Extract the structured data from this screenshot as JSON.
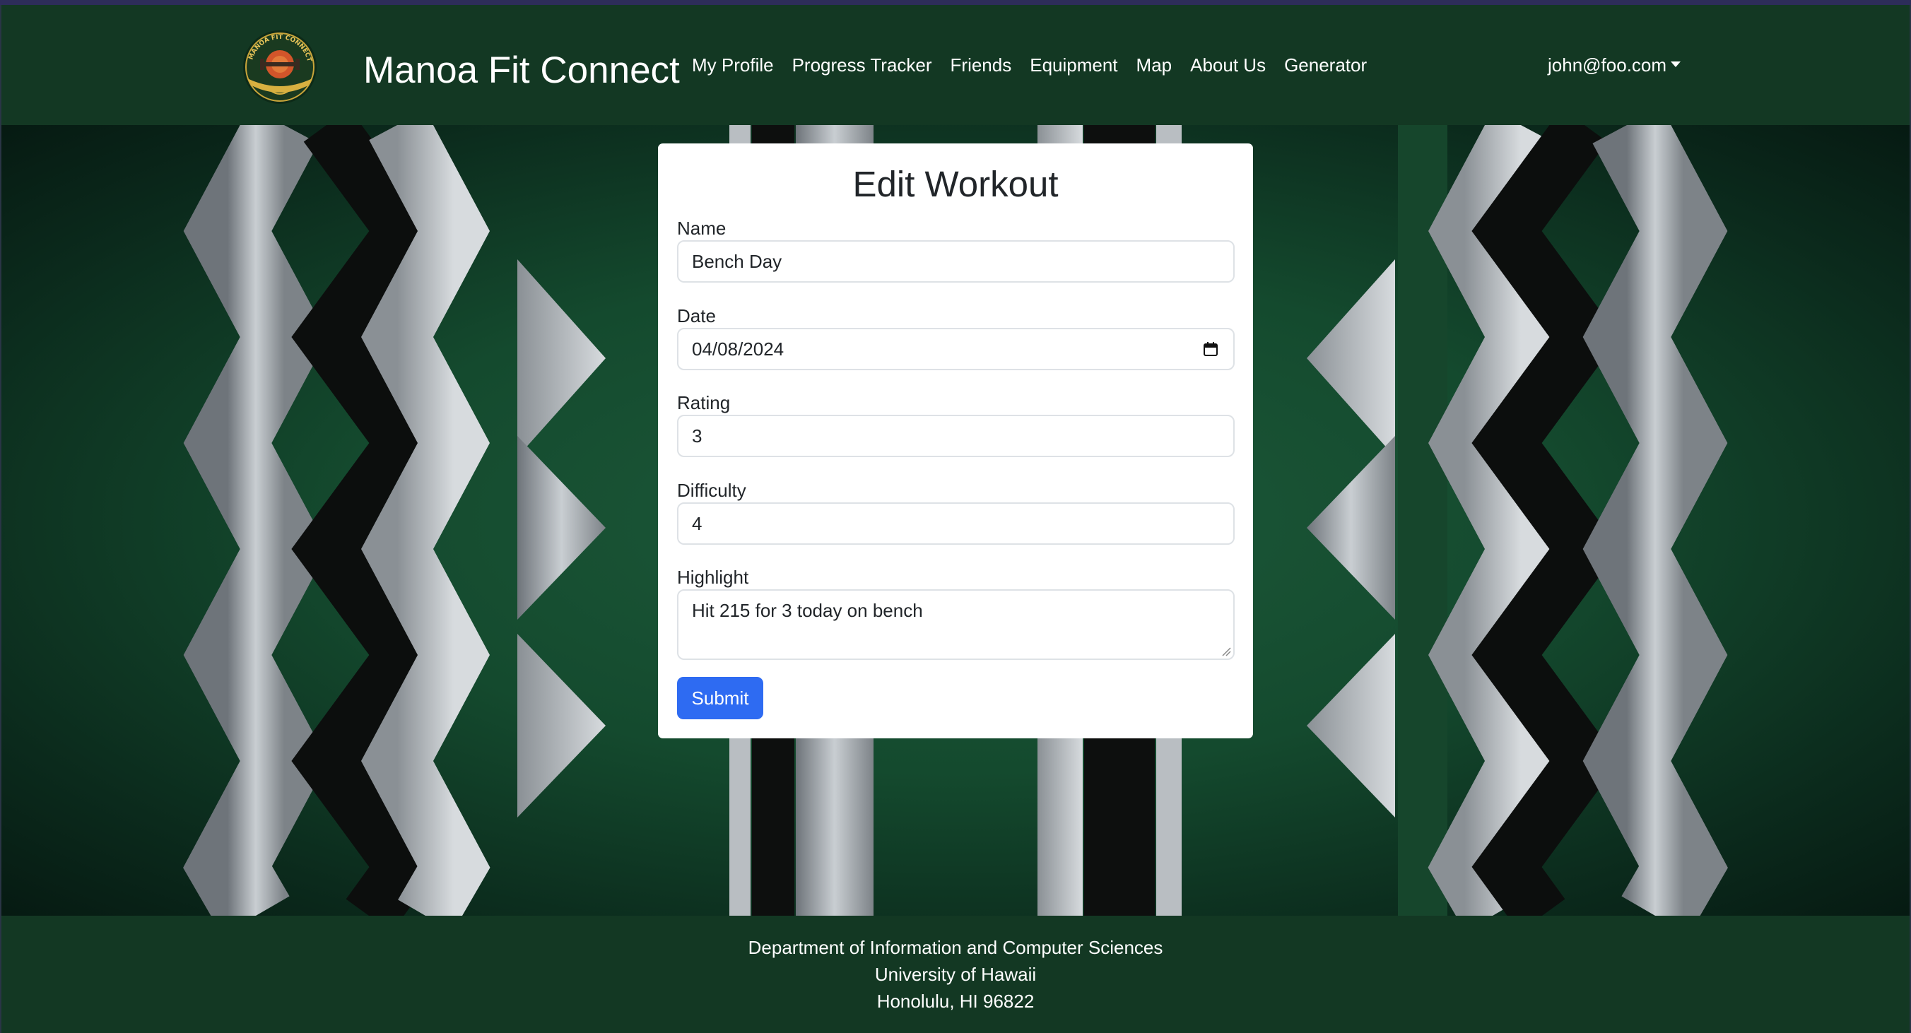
{
  "app": {
    "brand": "Manoa Fit Connect",
    "logo_text": "MANOA FIT CONNECT"
  },
  "nav": {
    "links": [
      "My Profile",
      "Progress Tracker",
      "Friends",
      "Equipment",
      "Map",
      "About Us",
      "Generator"
    ],
    "user": "john@foo.com"
  },
  "form": {
    "title": "Edit Workout",
    "fields": {
      "name": {
        "label": "Name",
        "value": "Bench Day"
      },
      "date": {
        "label": "Date",
        "value": "04/08/2024"
      },
      "rating": {
        "label": "Rating",
        "value": "3"
      },
      "difficulty": {
        "label": "Difficulty",
        "value": "4"
      },
      "highlight": {
        "label": "Highlight",
        "value": "Hit 215 for 3 today on bench"
      }
    },
    "submit_label": "Submit"
  },
  "footer": {
    "lines": [
      "Department of Information and Computer Sciences",
      "University of Hawaii",
      "Honolulu, HI 96822"
    ]
  },
  "colors": {
    "navbar": "#133823",
    "primary_button": "#2e6bf2",
    "background_green": "#1d5a3a"
  }
}
